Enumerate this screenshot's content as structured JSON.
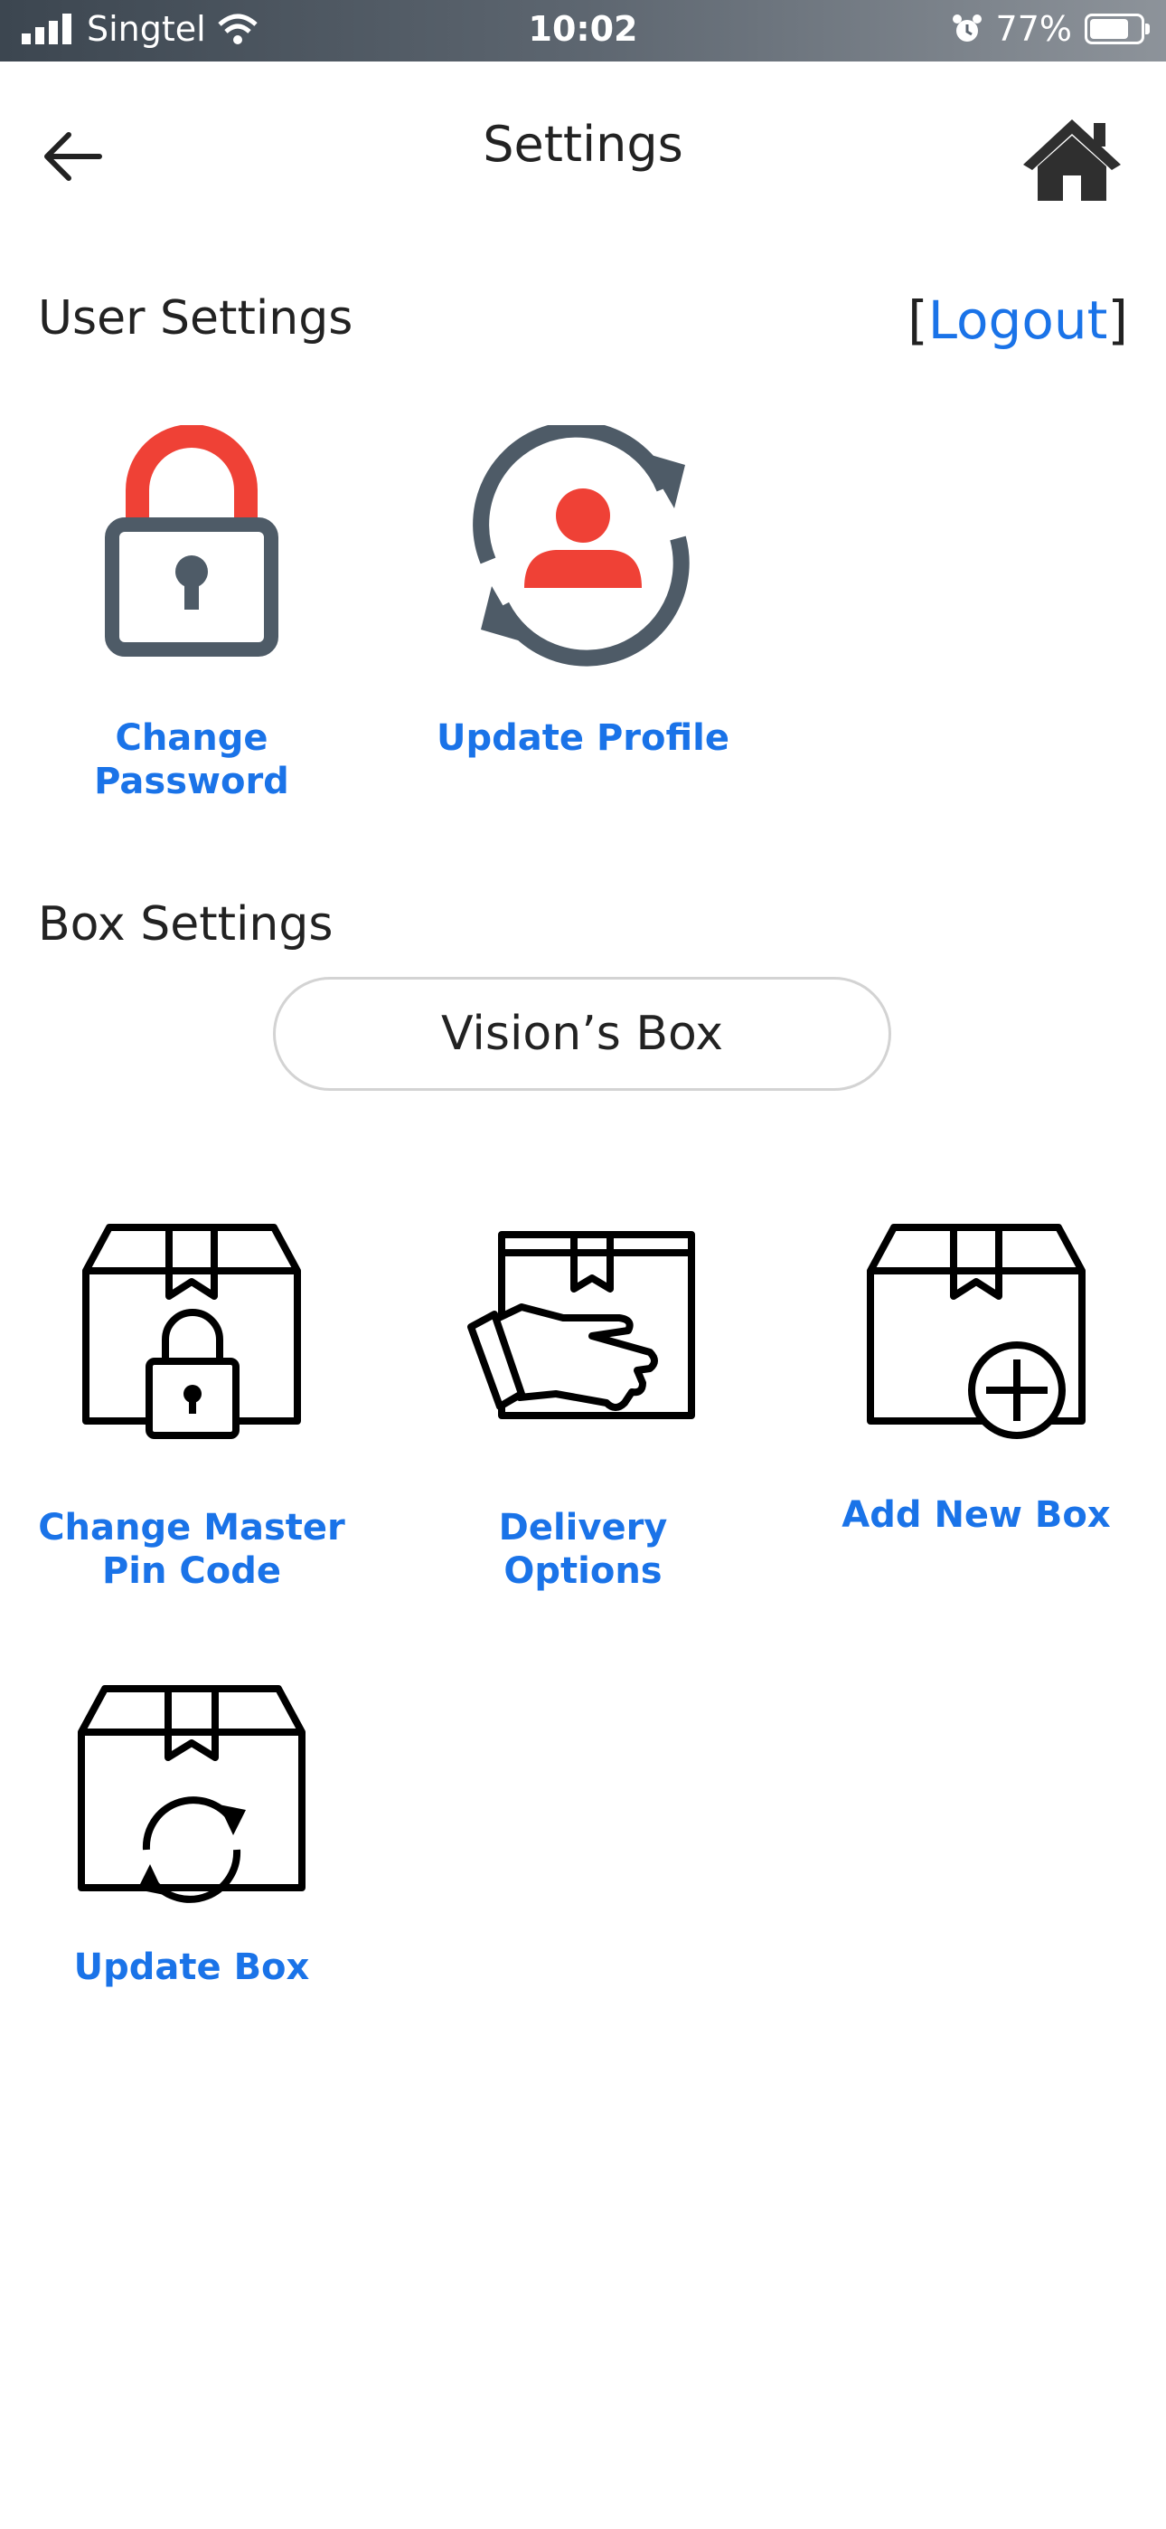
{
  "status": {
    "carrier": "Singtel",
    "time": "10:02",
    "battery": "77%",
    "battery_level": 0.77
  },
  "header": {
    "title": "Settings"
  },
  "user_settings": {
    "title": "User Settings",
    "logout_open": "[",
    "logout_text": "Logout",
    "logout_close": "]",
    "change_password": "Change Password",
    "update_profile": "Update Profile"
  },
  "box_settings": {
    "title": "Box Settings",
    "selected_box": "Vision’s Box",
    "change_master_pin": "Change Master Pin Code",
    "delivery_options": "Delivery Options",
    "add_new_box": "Add New Box",
    "update_box": "Update Box"
  },
  "colors": {
    "accent": "#1a73e8",
    "icon_slate": "#4e5b67",
    "icon_red": "#ef4136"
  }
}
